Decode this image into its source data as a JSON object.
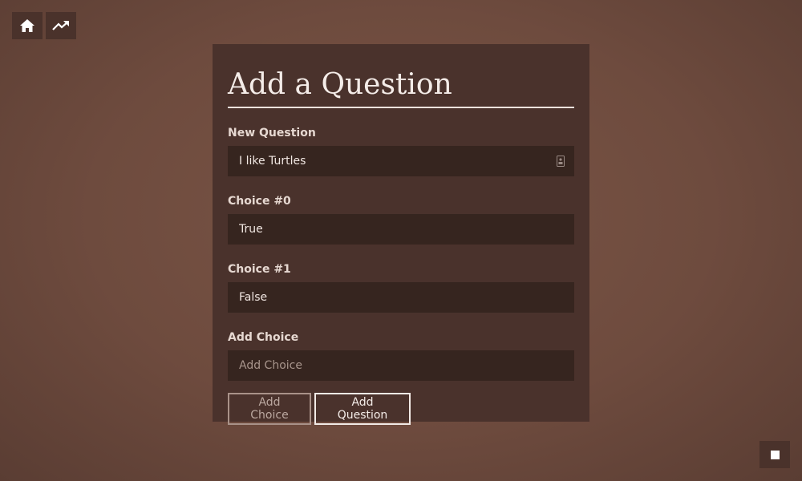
{
  "nav": {
    "home_icon": "home-icon",
    "trend_icon": "trending-up-icon"
  },
  "form": {
    "title": "Add a Question",
    "new_question": {
      "label": "New Question",
      "value": "I like Turtles"
    },
    "choices": [
      {
        "label": "Choice #0",
        "value": "True"
      },
      {
        "label": "Choice #1",
        "value": "False"
      }
    ],
    "add_choice": {
      "label": "Add Choice",
      "placeholder": "Add Choice"
    },
    "buttons": {
      "add_choice_label": "Add Choice",
      "add_question_label": "Add Question"
    }
  },
  "colors": {
    "background": "#6e4b3e",
    "panel": "#4a322c",
    "input": "#36251f",
    "text": "#f4ece8"
  }
}
